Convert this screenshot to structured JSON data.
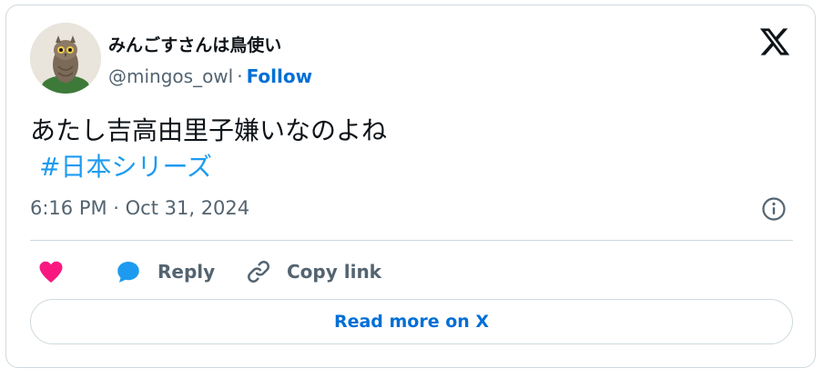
{
  "author": {
    "display_name": "みんごすさんは鳥使い",
    "handle": "@mingos_owl",
    "separator": "·",
    "follow_label": "Follow"
  },
  "tweet": {
    "text": "あたし吉高由里子嫌いなのよね",
    "hashtag": "#日本シリーズ",
    "timestamp": "6:16 PM · Oct 31, 2024"
  },
  "actions": {
    "like_icon": "heart-icon",
    "reply_label": "Reply",
    "copy_link_label": "Copy link"
  },
  "footer": {
    "read_more_label": "Read more on X"
  },
  "colors": {
    "accent": "#006fd6",
    "hashtag": "#1d9bf0",
    "like": "#f91880",
    "reply": "#1d9bf0",
    "muted": "#536471",
    "border": "#cfd9de"
  }
}
